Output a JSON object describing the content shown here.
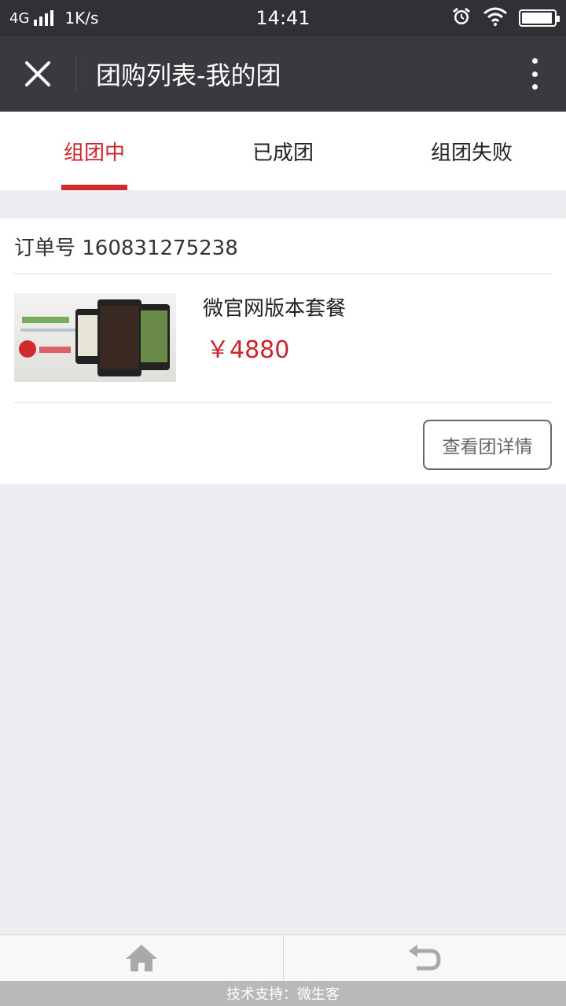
{
  "status_bar": {
    "network": "4G",
    "speed": "1K/s",
    "time": "14:41",
    "battery_level": 0.95,
    "icons": [
      "signal-icon",
      "alarm-icon",
      "wifi-icon",
      "battery-icon"
    ]
  },
  "header": {
    "title": "团购列表-我的团",
    "icons": [
      "close-icon",
      "more-icon"
    ]
  },
  "tabs": [
    {
      "label": "组团中",
      "active": true
    },
    {
      "label": "已成团",
      "active": false
    },
    {
      "label": "组团失败",
      "active": false
    }
  ],
  "order": {
    "order_label": "订单号 160831275238",
    "product_name": "微官网版本套餐",
    "price": "￥4880",
    "detail_button": "查看团详情"
  },
  "bottom_nav": {
    "icons": [
      "home-icon",
      "back-icon"
    ]
  },
  "footer": {
    "text": "技术支持：微生客"
  },
  "colors": {
    "accent": "#c8252c",
    "title_bar": "#393a3f",
    "status_bar": "#2f3134",
    "background": "#eceef1"
  }
}
